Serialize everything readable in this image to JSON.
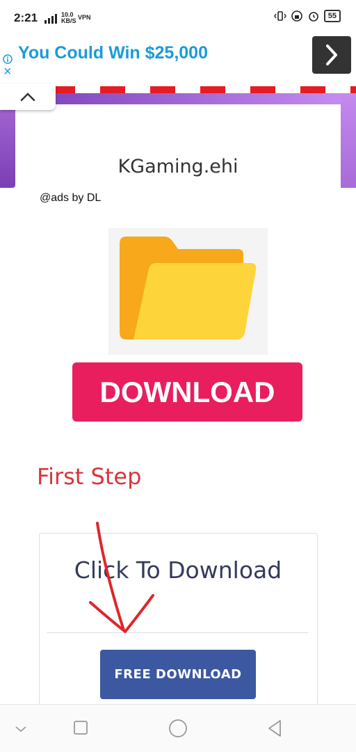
{
  "status_bar": {
    "time": "2:21",
    "network_top": "10.0",
    "network_bottom": "KB/S",
    "vpn": "VPN",
    "battery": "55"
  },
  "ad": {
    "text": "You Could Win $25,000",
    "close_symbol": "×"
  },
  "page": {
    "title": "KGaming.ehi",
    "ads_by": "@ads by DL",
    "download_image_label": "DOWNLOAD",
    "first_step": "First Step",
    "click_to_download": "Click To Download",
    "free_download_button": "FREE DOWNLOAD"
  },
  "colors": {
    "ad_blue": "#1a9bd8",
    "download_pink": "#e91e5f",
    "free_download_blue": "#3b58a0",
    "first_step_red": "#d9343a"
  }
}
